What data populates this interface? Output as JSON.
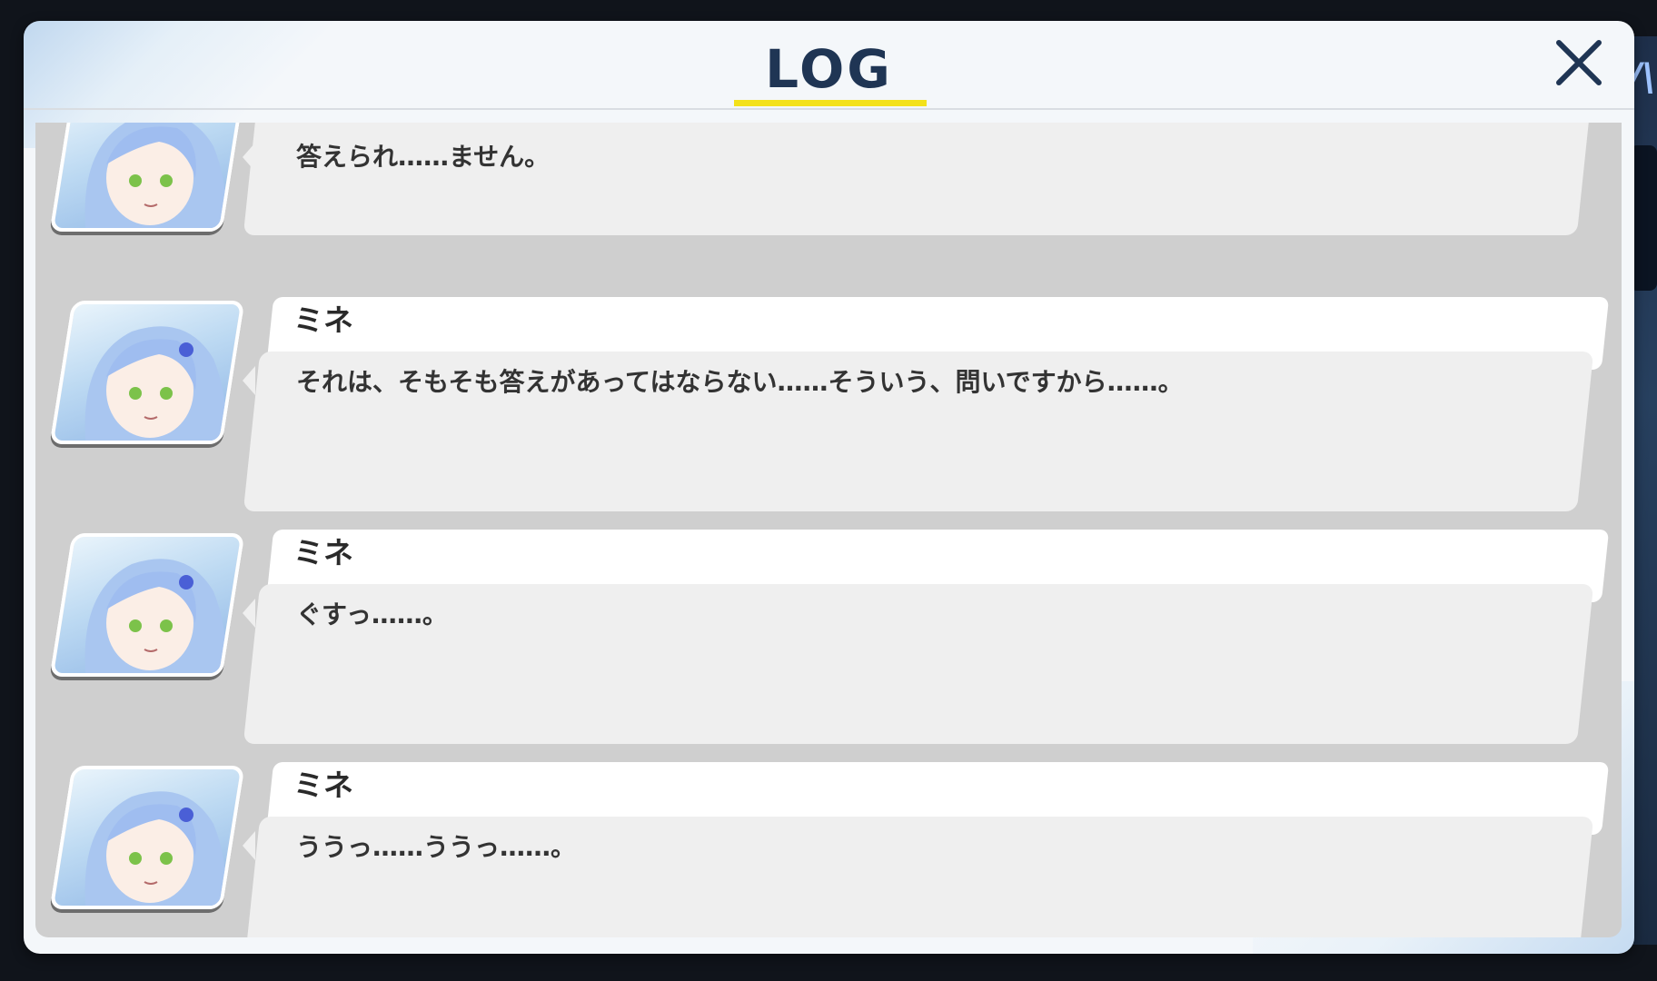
{
  "header": {
    "title": "LOG",
    "close_icon": "close-icon",
    "underline_color": "#f3e11b"
  },
  "colors": {
    "title": "#1f3554",
    "name_bg": "#ffffff",
    "message_bg": "#efefef",
    "log_bg": "#cfcfcf"
  },
  "entries": [
    {
      "speaker": "",
      "text": "答えられ……ません。",
      "avatar_icon": "character-portrait-icon"
    },
    {
      "speaker": "ミネ",
      "text": "それは、そもそも答えがあってはならない……そういう、問いですから……。",
      "avatar_icon": "character-portrait-icon"
    },
    {
      "speaker": "ミネ",
      "text": "ぐすっ……。",
      "avatar_icon": "character-portrait-icon"
    },
    {
      "speaker": "ミネ",
      "text": "ううっ……ううっ……。",
      "avatar_icon": "character-portrait-icon"
    }
  ]
}
